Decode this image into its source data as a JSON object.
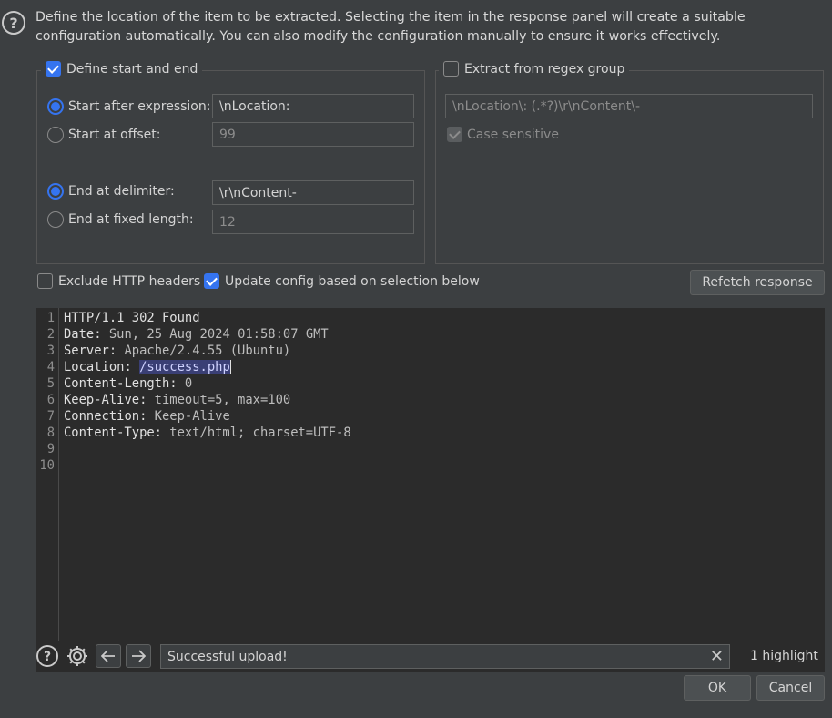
{
  "description": "Define the location of the item to be extracted. Selecting the item in the response panel will create a suitable configuration automatically. You can also modify the configuration manually to ensure it works effectively.",
  "start_end": {
    "legend": "Define start and end",
    "start_after_label": "Start after expression:",
    "start_after_value": "\\nLocation:",
    "start_offset_label": "Start at offset:",
    "start_offset_value": "99",
    "end_delim_label": "End at delimiter:",
    "end_delim_value": "\\r\\nContent-",
    "end_fixed_label": "End at fixed length:",
    "end_fixed_value": "12"
  },
  "regex": {
    "legend": "Extract from regex group",
    "value": "\\nLocation\\: (.*?)\\r\\nContent\\-",
    "case_label": "Case sensitive"
  },
  "options": {
    "exclude_headers": "Exclude HTTP headers",
    "update_config": "Update config based on selection below",
    "refetch": "Refetch response"
  },
  "response_lines": [
    {
      "n": "1",
      "key": "HTTP/1.1 302 Found",
      "val": ""
    },
    {
      "n": "2",
      "key": "Date:",
      "val": " Sun, 25 Aug 2024 01:58:07 GMT"
    },
    {
      "n": "3",
      "key": "Server:",
      "val": " Apache/2.4.55 (Ubuntu)"
    },
    {
      "n": "4",
      "key": "Location:",
      "val": " ",
      "hl": "/success.php"
    },
    {
      "n": "5",
      "key": "Content-Length:",
      "val": " 0"
    },
    {
      "n": "6",
      "key": "Keep-Alive:",
      "val": " timeout=5, max=100"
    },
    {
      "n": "7",
      "key": "Connection:",
      "val": " Keep-Alive"
    },
    {
      "n": "8",
      "key": "Content-Type:",
      "val": " text/html; charset=UTF-8"
    },
    {
      "n": "9",
      "key": "",
      "val": ""
    },
    {
      "n": "10",
      "key": "",
      "val": ""
    }
  ],
  "search": {
    "value": "Successful upload!",
    "count": "1 highlight"
  },
  "buttons": {
    "ok": "OK",
    "cancel": "Cancel"
  }
}
